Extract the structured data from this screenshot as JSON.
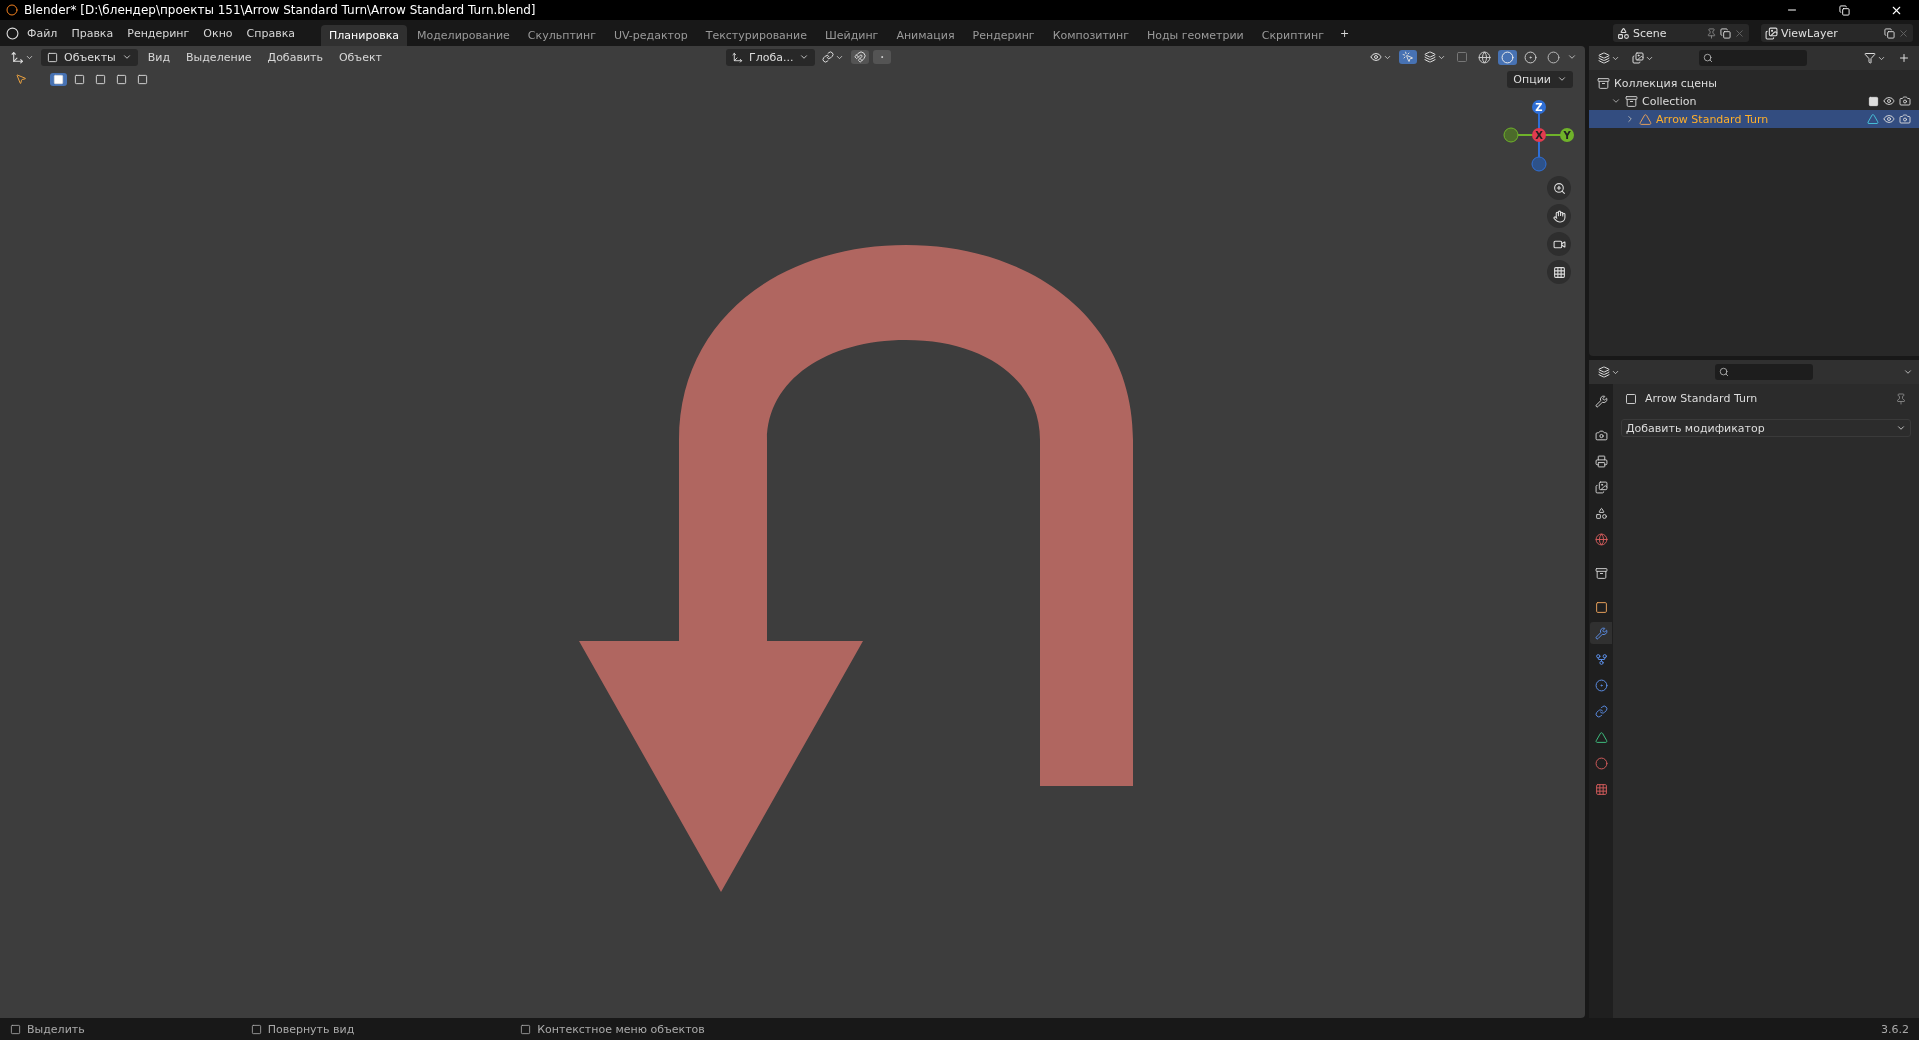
{
  "window": {
    "title": "Blender* [D:\\блендер\\проекты 151\\Arrow Standard Turn\\Arrow Standard Turn.blend]"
  },
  "menu": [
    "Файл",
    "Правка",
    "Рендеринг",
    "Окно",
    "Справка"
  ],
  "workspaces": [
    {
      "label": "Планировка",
      "selected": true
    },
    {
      "label": "Моделирование",
      "selected": false
    },
    {
      "label": "Скульптинг",
      "selected": false
    },
    {
      "label": "UV-редактор",
      "selected": false
    },
    {
      "label": "Текстурирование",
      "selected": false
    },
    {
      "label": "Шейдинг",
      "selected": false
    },
    {
      "label": "Анимация",
      "selected": false
    },
    {
      "label": "Рендеринг",
      "selected": false
    },
    {
      "label": "Композитинг",
      "selected": false
    },
    {
      "label": "Ноды геометрии",
      "selected": false
    },
    {
      "label": "Скриптинг",
      "selected": false
    }
  ],
  "add_workspace": "+",
  "scene": "Scene",
  "view_layer": "ViewLayer",
  "viewport": {
    "mode": "Объекты",
    "menus": [
      "Вид",
      "Выделение",
      "Добавить",
      "Объект"
    ],
    "orientation": "Глоба...",
    "options": "Опции",
    "shading": [
      {
        "kind": "wireframe",
        "selected": false
      },
      {
        "kind": "solid",
        "selected": true
      },
      {
        "kind": "material",
        "selected": false
      },
      {
        "kind": "rendered",
        "selected": false
      }
    ],
    "select_modes": [
      {
        "selected": true
      },
      {
        "selected": false
      },
      {
        "selected": false
      },
      {
        "selected": false
      },
      {
        "selected": false
      }
    ],
    "gizmo_toggle_on": true,
    "axes": [
      "Z",
      "X",
      "Y"
    ]
  },
  "outliner": {
    "items": [
      {
        "label": "Коллекция сцены",
        "kind": "scene_collection",
        "children": [
          {
            "label": "Collection",
            "kind": "collection",
            "expanded": true,
            "checked": true,
            "selected": false,
            "children": [
              {
                "label": "Arrow Standard Turn",
                "kind": "object",
                "expanded": false,
                "selected": true
              }
            ]
          }
        ]
      }
    ]
  },
  "properties": {
    "object_name": "Arrow Standard Turn",
    "add_modifier": "Добавить модификатор",
    "tabs": [
      {
        "kind": "tool",
        "selected": false
      },
      {
        "kind": "render",
        "selected": false
      },
      {
        "kind": "output",
        "selected": false
      },
      {
        "kind": "view_layer",
        "selected": false
      },
      {
        "kind": "scene",
        "selected": false
      },
      {
        "kind": "world",
        "selected": false
      },
      {
        "kind": "collection",
        "selected": false
      },
      {
        "kind": "object",
        "selected": false
      },
      {
        "kind": "modifiers",
        "selected": true
      },
      {
        "kind": "particles",
        "selected": false
      },
      {
        "kind": "physics",
        "selected": false
      },
      {
        "kind": "constraints",
        "selected": false
      },
      {
        "kind": "data",
        "selected": false
      },
      {
        "kind": "material",
        "selected": false
      },
      {
        "kind": "texture",
        "selected": false
      }
    ]
  },
  "status_bar": {
    "hints": [
      "Выделить",
      "Повернуть вид",
      "Контекстное меню объектов"
    ],
    "version": "3.6.2"
  }
}
